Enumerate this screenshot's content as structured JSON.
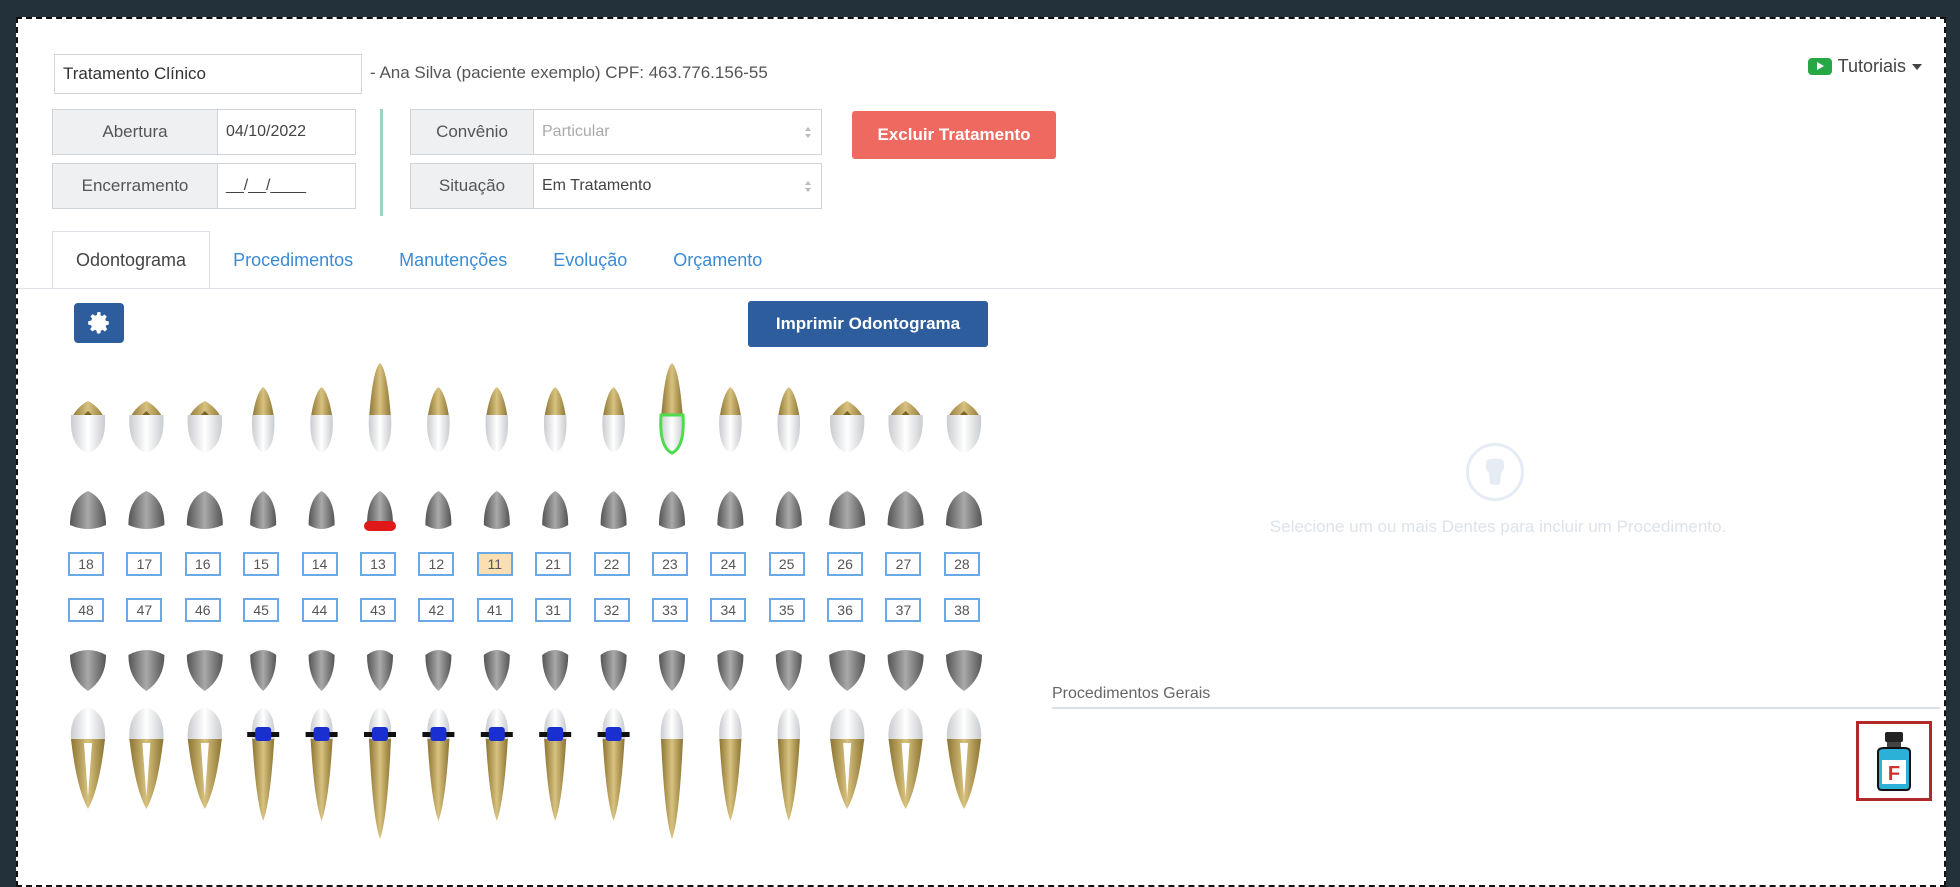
{
  "treatment": {
    "title": "Tratamento Clínico",
    "patient_line": "- Ana Silva (paciente exemplo)   CPF:  463.776.156-55"
  },
  "header": {
    "tutorials_label": "Tutoriais"
  },
  "dates": {
    "opening_label": "Abertura",
    "opening_value": "04/10/2022",
    "closing_label": "Encerramento",
    "closing_value": "__/__/____"
  },
  "fields": {
    "insurance_label": "Convênio",
    "insurance_value": "Particular",
    "status_label": "Situação",
    "status_value": "Em Tratamento"
  },
  "actions": {
    "delete_label": "Excluir Tratamento",
    "print_label": "Imprimir Odontograma"
  },
  "tabs": [
    {
      "label": "Odontograma",
      "active": true
    },
    {
      "label": "Procedimentos"
    },
    {
      "label": "Manutenções"
    },
    {
      "label": "Evolução"
    },
    {
      "label": "Orçamento"
    }
  ],
  "odontogram": {
    "upper_numbers": [
      "18",
      "17",
      "16",
      "15",
      "14",
      "13",
      "12",
      "11",
      "21",
      "22",
      "23",
      "24",
      "25",
      "26",
      "27",
      "28"
    ],
    "lower_numbers": [
      "48",
      "47",
      "46",
      "45",
      "44",
      "43",
      "42",
      "41",
      "31",
      "32",
      "33",
      "34",
      "35",
      "36",
      "37",
      "38"
    ],
    "selected_tooth": "11",
    "highlighted_tooth": "23",
    "red_mark_tooth": "13",
    "braces_teeth": [
      "45",
      "44",
      "43",
      "42",
      "41",
      "31",
      "32"
    ]
  },
  "side_panel": {
    "empty_message": "Selecione um ou mais Dentes para incluir um Procedimento.",
    "general_label": "Procedimentos Gerais"
  },
  "icons": {
    "gear": "gear-icon",
    "tooth": "tooth-icon",
    "video": "video-icon",
    "fluoride": "fluoride-bottle-icon"
  },
  "colors": {
    "primary": "#2d5d9c",
    "danger": "#ee6a60",
    "link": "#3a8bd6",
    "tooth_root": "#b9a060",
    "selected": "#f9dfb2"
  }
}
